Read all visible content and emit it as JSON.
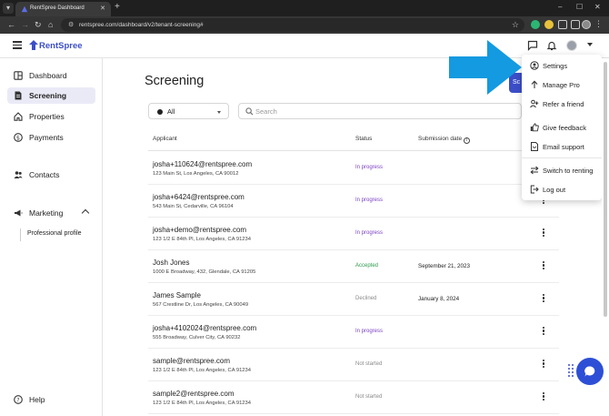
{
  "browser": {
    "tab_title": "RentSpree Dashboard",
    "url": "rentspree.com/dashboard/v2/tenant-screening#"
  },
  "app": {
    "brand": "RentSpree",
    "accent": "#3b4ec8"
  },
  "sidebar": {
    "items": [
      {
        "label": "Dashboard",
        "icon": "home-grid-icon"
      },
      {
        "label": "Screening",
        "icon": "document-icon",
        "active": true
      },
      {
        "label": "Properties",
        "icon": "house-icon"
      },
      {
        "label": "Payments",
        "icon": "dollar-circle-icon"
      },
      {
        "label": "Contacts",
        "icon": "people-icon"
      },
      {
        "label": "Marketing",
        "icon": "megaphone-icon"
      }
    ],
    "marketing_sub": "Professional profile",
    "help": "Help"
  },
  "main": {
    "title": "Screening",
    "create_label": "Sc",
    "filter_value": "All",
    "search_placeholder": "Search",
    "columns": {
      "applicant": "Applicant",
      "status": "Status",
      "submission_date": "Submission date"
    },
    "rows": [
      {
        "email": "josha+110624@rentspree.com",
        "address": "123 Main St, Los Angeles, CA 90012",
        "status": "In progress",
        "status_color": "#7b3fbf",
        "date": ""
      },
      {
        "email": "josha+6424@rentspree.com",
        "address": "543 Main St, Cedarville, CA 96104",
        "status": "In progress",
        "status_color": "#7b3fbf",
        "date": ""
      },
      {
        "email": "josha+demo@rentspree.com",
        "address": "123 1/2 E 84th Pl, Los Angeles, CA 91234",
        "status": "In progress",
        "status_color": "#7b3fbf",
        "date": ""
      },
      {
        "email": "Josh Jones",
        "address": "1000 E Broadway, 432, Glendale, CA 91205",
        "status": "Accepted",
        "status_color": "#2e9a4a",
        "date": "September 21, 2023"
      },
      {
        "email": "James Sample",
        "address": "567 Crestline Dr, Los Angeles, CA 90049",
        "status": "Declined",
        "status_color": "#8a8a8a",
        "date": "January 8, 2024"
      },
      {
        "email": "josha+4102024@rentspree.com",
        "address": "555 Broadway, Culver City, CA 90232",
        "status": "In progress",
        "status_color": "#7b3fbf",
        "date": ""
      },
      {
        "email": "sample@rentspree.com",
        "address": "123 1/2 E 84th Pl, Los Angeles, CA 91234",
        "status": "Not started",
        "status_color": "#8a8a8a",
        "date": ""
      },
      {
        "email": "sample2@rentspree.com",
        "address": "123 1/2 E 84th Pl, Los Angeles, CA 91234",
        "status": "Not started",
        "status_color": "#8a8a8a",
        "date": ""
      }
    ]
  },
  "menu": {
    "items": [
      {
        "label": "Settings",
        "icon": "gear-user-icon"
      },
      {
        "label": "Manage Pro",
        "icon": "arrow-up-icon"
      },
      {
        "label": "Refer a friend",
        "icon": "add-person-icon"
      },
      {
        "label": "Give feedback",
        "icon": "thumbs-up-icon"
      },
      {
        "label": "Email support",
        "icon": "email-doc-icon"
      },
      {
        "label": "Switch to renting",
        "icon": "swap-icon"
      },
      {
        "label": "Log out",
        "icon": "logout-icon"
      }
    ]
  }
}
